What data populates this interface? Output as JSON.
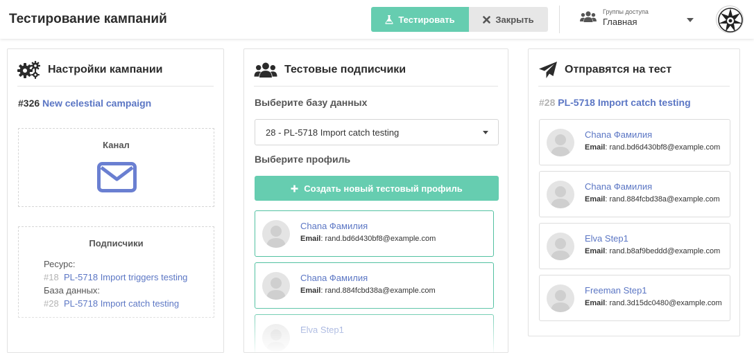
{
  "header": {
    "title": "Тестирование кампаний",
    "test_label": "Тестировать",
    "close_label": "Закрыть",
    "access_label": "Группы доступа",
    "access_value": "Главная"
  },
  "settings": {
    "title": "Настройки кампании",
    "campaign_id": "#326",
    "campaign_name": "New celestial campaign",
    "channel_title": "Канал",
    "subscribers_title": "Подписчики",
    "resource_label": "Ресурс:",
    "resource_id": "#18",
    "resource_name": "PL-5718 Import triggers testing",
    "db_label": "База данных:",
    "db_id": "#28",
    "db_name": "PL-5718 Import catch testing"
  },
  "test_subscribers": {
    "title": "Тестовые подписчики",
    "db_select_label": "Выберите базу данных",
    "db_selected": "28 - PL-5718 Import catch testing",
    "profile_label": "Выберите профиль",
    "create_label": "Создать новый тестовый профиль",
    "email_label": "Email",
    "profiles": [
      {
        "name": "Chana Фамилия",
        "email": "rand.bd6d430bf8@example.com"
      },
      {
        "name": "Chana Фамилия",
        "email": "rand.884fcbd38a@example.com"
      },
      {
        "name": "Elva Step1",
        "email": ""
      }
    ]
  },
  "send_test": {
    "title": "Отправятся на тест",
    "db_id": "#28",
    "db_name": "PL-5718 Import catch testing",
    "email_label": "Email",
    "recipients": [
      {
        "name": "Chana Фамилия",
        "email": "rand.bd6d430bf8@example.com"
      },
      {
        "name": "Chana Фамилия",
        "email": "rand.884fcbd38a@example.com"
      },
      {
        "name": "Elva Step1",
        "email": "rand.b8af9beddd@example.com"
      },
      {
        "name": "Freeman Step1",
        "email": "rand.3d15dc0480@example.com"
      }
    ]
  },
  "colors": {
    "accent": "#66cdb0",
    "link": "#5b76c4",
    "channel_icon": "#6a7fd1"
  },
  "icons": {
    "test": "flask-icon",
    "close": "x-icon",
    "access": "users-icon",
    "settings": "gears-icon",
    "subscribers": "users-icon",
    "send": "paper-plane-icon",
    "channel": "envelope-icon"
  }
}
